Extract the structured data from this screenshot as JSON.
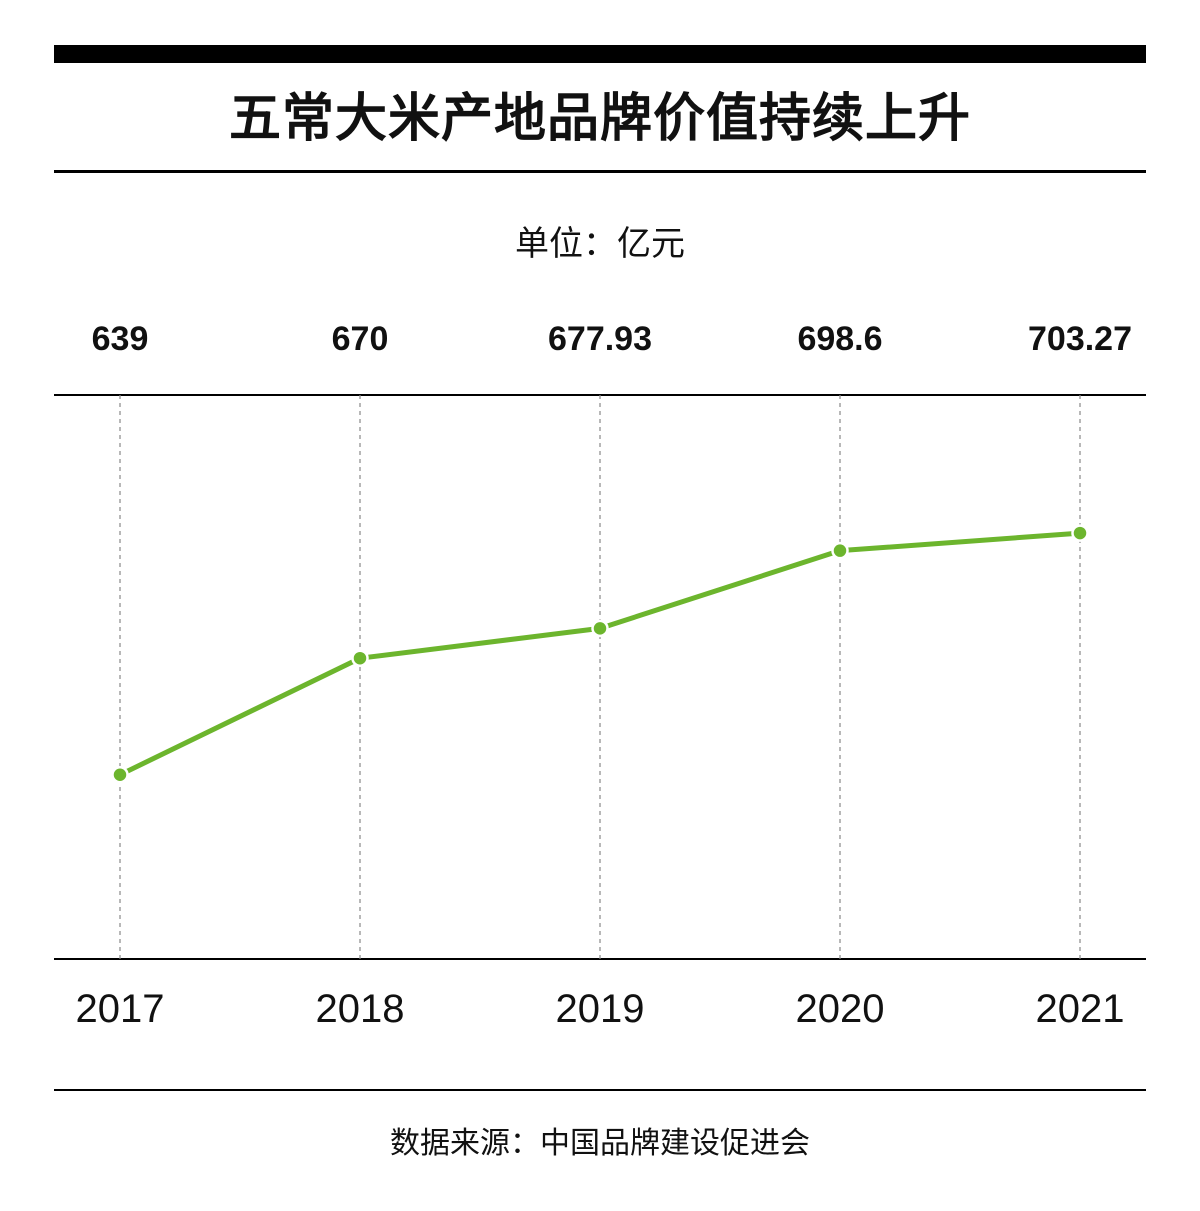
{
  "title": "五常大米产地品牌价值持续上升",
  "unit_label": "单位：亿元",
  "source_label": "数据来源：中国品牌建设促进会",
  "colors": {
    "line": "#6cb52d",
    "marker": "#6cb52d",
    "axis": "#000000",
    "gridline": "#888888"
  },
  "chart_data": {
    "type": "line",
    "title": "五常大米产地品牌价值持续上升",
    "xlabel": "",
    "ylabel": "单位：亿元",
    "categories": [
      "2017",
      "2018",
      "2019",
      "2020",
      "2021"
    ],
    "value_labels": [
      "639",
      "670",
      "677.93",
      "698.6",
      "703.27"
    ],
    "series": [
      {
        "values": [
          639,
          670,
          677.93,
          698.6,
          703.27
        ]
      }
    ],
    "ylim": [
      590,
      740
    ],
    "grid": "vertical dashed",
    "legend": "none"
  }
}
